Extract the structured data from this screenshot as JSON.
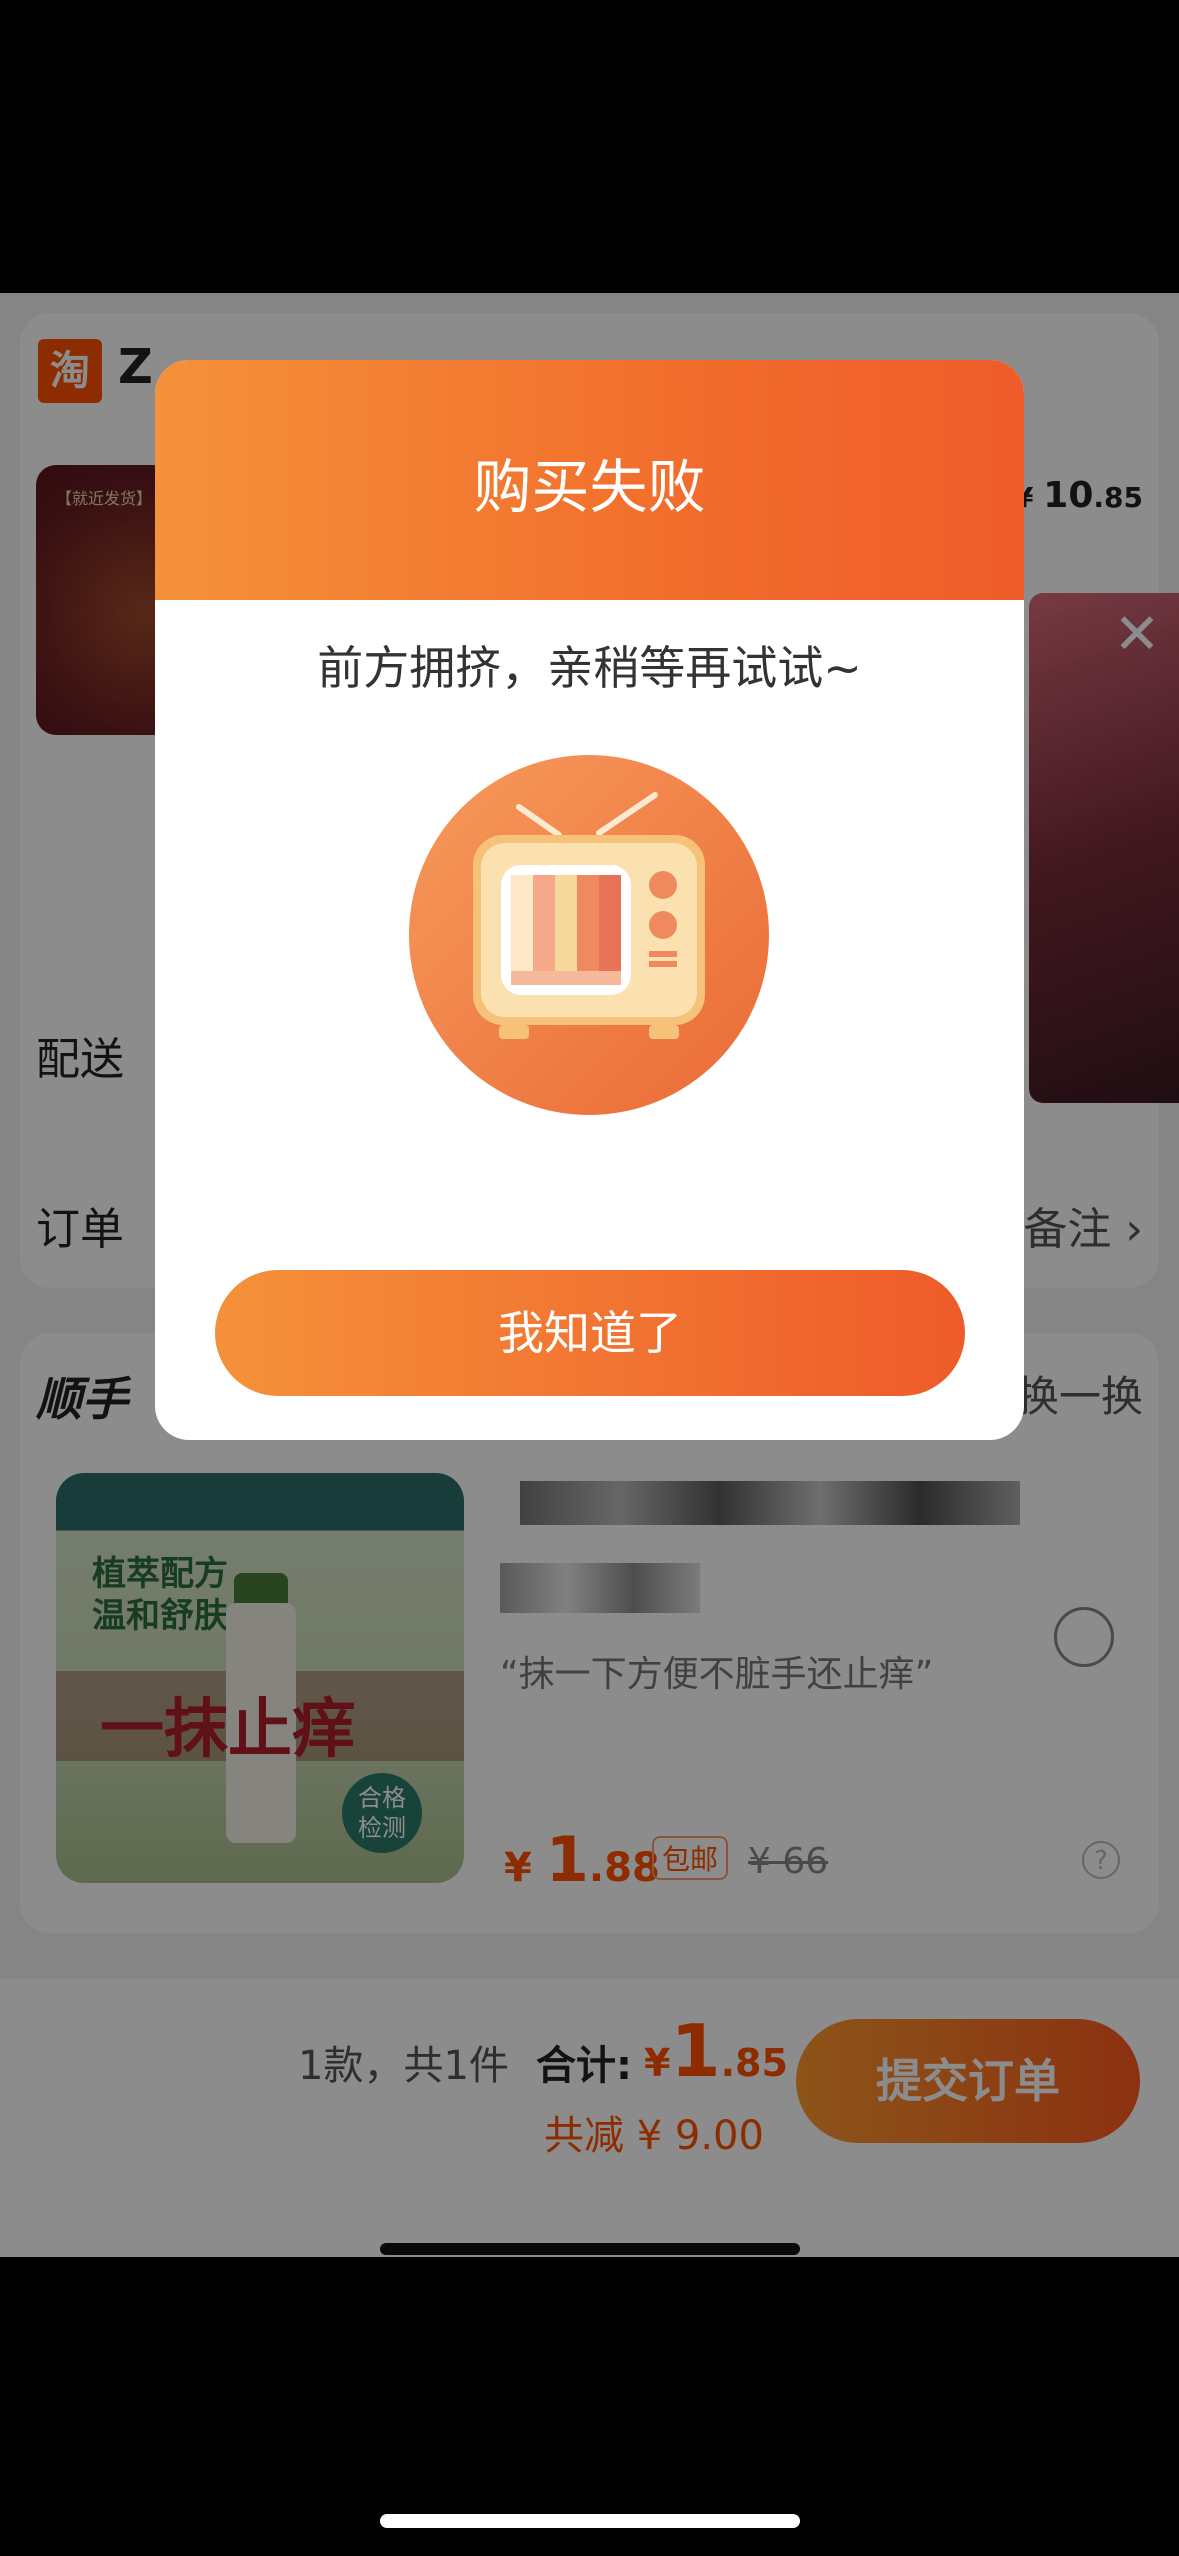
{
  "order_page": {
    "shop": {
      "logo_text": "淘",
      "name_fragment": "Z"
    },
    "item": {
      "thumb_tag": "【就近发货】",
      "price_symbol": "¥",
      "price_int": "10",
      "price_dec": ".85"
    },
    "ad_close": "✕",
    "delivery_label": "配送",
    "order_note_label": "订单",
    "order_note_right": "备注 ›",
    "addon": {
      "title": "顺手",
      "swap": "换一换",
      "img_text": "植萃配方\n温和舒肤",
      "img_big": "一抹止痒",
      "img_badge": "合格\n检测",
      "desc": "“抹一下方便不脏手还止痒”",
      "price_symbol": "¥",
      "price_int": "1",
      "price_dec": ".88",
      "free_ship": "包邮",
      "orig_price": "¥ 66",
      "help_icon": "?"
    },
    "bottom": {
      "count_text": "1款，共1件",
      "total_label": "合计:",
      "total_symbol": "¥",
      "total_int": "1",
      "total_dec": ".85",
      "saved": "共减 ¥ 9.00",
      "submit": "提交订单"
    }
  },
  "dialog": {
    "title": "购买失败",
    "message": "前方拥挤，亲稍等再试试~",
    "illustration": "tv-icon",
    "button": "我知道了"
  },
  "colors": {
    "accent": "#ff5000",
    "dialog_gradient_start": "#f5913a",
    "dialog_gradient_end": "#ee5b2a"
  }
}
